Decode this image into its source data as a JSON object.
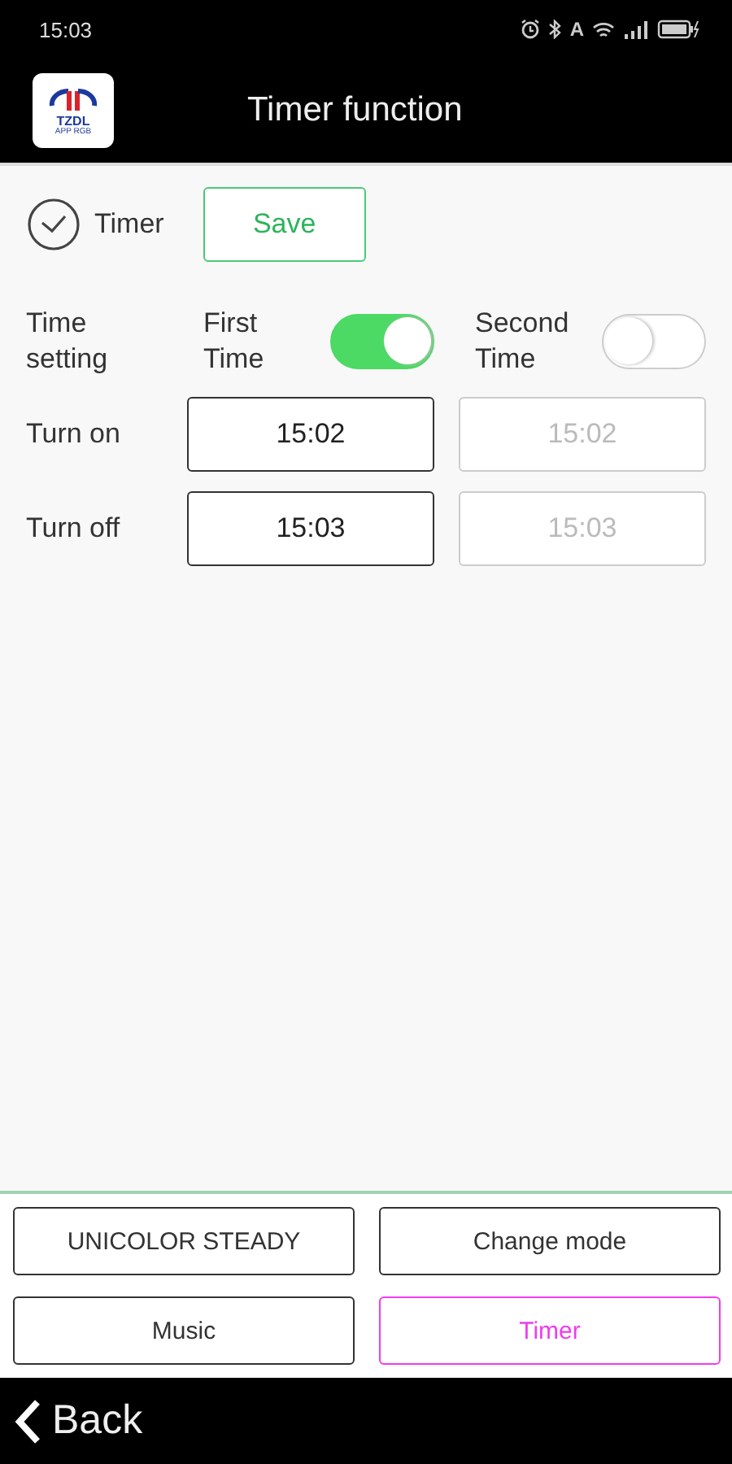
{
  "status_bar": {
    "time": "15:03",
    "indicator": "A"
  },
  "header": {
    "logo_text": "TZDL",
    "logo_subtext": "APP RGB",
    "title": "Timer function"
  },
  "timer": {
    "label": "Timer",
    "save": "Save"
  },
  "time_setting": {
    "label": "Time setting",
    "turn_on_label": "Turn on",
    "turn_off_label": "Turn off",
    "slots": [
      {
        "label": "First Time",
        "on": true,
        "turn_on": "15:02",
        "turn_off": "15:03"
      },
      {
        "label": "Second Time",
        "on": false,
        "turn_on": "15:02",
        "turn_off": "15:03"
      }
    ]
  },
  "nav_buttons": [
    {
      "label": "UNICOLOR STEADY",
      "selected": false
    },
    {
      "label": "Change mode",
      "selected": false
    },
    {
      "label": "Music",
      "selected": false
    },
    {
      "label": "Timer",
      "selected": true
    }
  ],
  "back": {
    "label": "Back"
  }
}
